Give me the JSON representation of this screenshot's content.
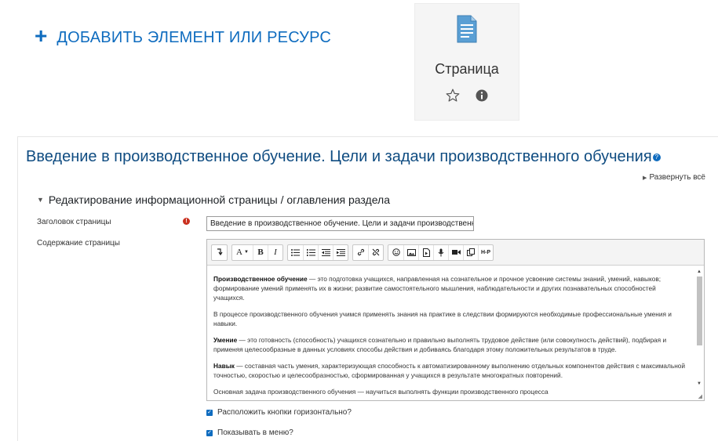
{
  "add_resource": {
    "plus": "+",
    "label": "ДОБАВИТЬ ЭЛЕМЕНТ ИЛИ РЕСУРС"
  },
  "tile": {
    "label": "Страница",
    "icons": [
      "page-doc-icon",
      "star-icon",
      "info-icon"
    ]
  },
  "form": {
    "title": "Введение в производственное обучение. Цели и задачи производственного обучения",
    "expand_all": "Развернуть всё",
    "section_title": "Редактирование информационной страницы / оглавления раздела",
    "page_title_label": "Заголовок страницы",
    "page_title_value": "Введение в производственное обучение. Цели и задачи производственного обу",
    "content_label": "Содержание страницы",
    "toolbar": [
      [
        "collapse"
      ],
      [
        "A▾",
        "B",
        "I"
      ],
      [
        "bullets",
        "numbers",
        "outdent",
        "indent"
      ],
      [
        "link",
        "unlink"
      ],
      [
        "emoji",
        "image",
        "media",
        "record-audio",
        "record-video",
        "manage-files",
        "H-P"
      ]
    ],
    "paragraphs": [
      {
        "term": "Производственное обучение",
        "text": " — это подготовка учащихся, направленная на сознательное и прочное усвоение системы знаний, умений, навыков; формирование умений применять их в жизни; развитие самостоятельного мышления, наблюдательности и других познавательных способностей учащихся."
      },
      {
        "term": "",
        "text": "В процессе производственного обучения учимся применять знания на практике в следствии формируются необходимые профессиональные умения и навыки."
      },
      {
        "term": "Умение",
        "text": " — это готовность (способность) учащихся сознательно и правильно выполнять трудовое действие (или совокупность действий), подбирая и применяя целесообразные в данных условиях способы действия и добиваясь благодаря этому положительных результатов в труде."
      },
      {
        "term": "Навык",
        "text": " — составная часть умения, характеризующая способность к автоматизированному выполнению отдельных компонентов действия с максимальной точностью, скоростью и целесообразностью, сформированная у учащихся в результате многократных повторений."
      },
      {
        "term": "",
        "text": "Основная задача производственного обучения — научиться выполнять функции производственного процесса"
      }
    ],
    "checkbox_horizontal": "Расположить кнопки горизонтально?",
    "checkbox_menu": "Показывать в меню?"
  },
  "colors": {
    "accent": "#0f6cbf",
    "title": "#0f4c81",
    "required": "#ca3120"
  }
}
